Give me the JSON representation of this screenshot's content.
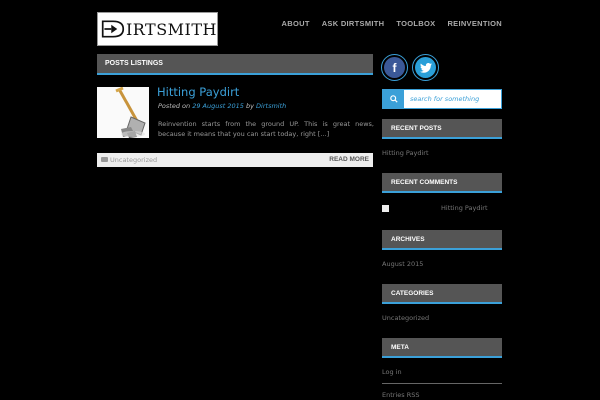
{
  "site": {
    "logo_text": "IRTSMITH"
  },
  "nav": {
    "items": [
      "ABOUT",
      "ASK DIRTSMITH",
      "TOOLBOX",
      "REINVENTION"
    ]
  },
  "main": {
    "section_title": "POSTS LISTINGS",
    "post": {
      "title": "Hitting Paydirt",
      "meta_prefix": "Posted on",
      "date": "29 August 2015",
      "by": "by",
      "author": "Dirtsmith",
      "excerpt": "Reinvention starts from the ground UP. This is great news, because it means that you can start today, right […]",
      "category": "Uncategorized",
      "read_more": "READ MORE"
    }
  },
  "sidebar": {
    "social": {
      "facebook": "f",
      "twitter": "t"
    },
    "search_placeholder": "search for something",
    "widgets": {
      "recent_posts": {
        "title": "RECENT POSTS",
        "items": [
          "Hitting Paydirt"
        ]
      },
      "recent_comments": {
        "title": "RECENT COMMENTS",
        "items": [
          "Hitting Paydirt"
        ]
      },
      "archives": {
        "title": "ARCHIVES",
        "items": [
          "August 2015"
        ]
      },
      "categories": {
        "title": "CATEGORIES",
        "items": [
          "Uncategorized"
        ]
      },
      "meta": {
        "title": "META",
        "items": [
          "Log in",
          "Entries RSS"
        ]
      }
    }
  },
  "colors": {
    "accent": "#3ba0d8",
    "background": "#000000",
    "bar": "#555555",
    "facebook": "#3b5998",
    "twitter": "#2a9fd8"
  }
}
